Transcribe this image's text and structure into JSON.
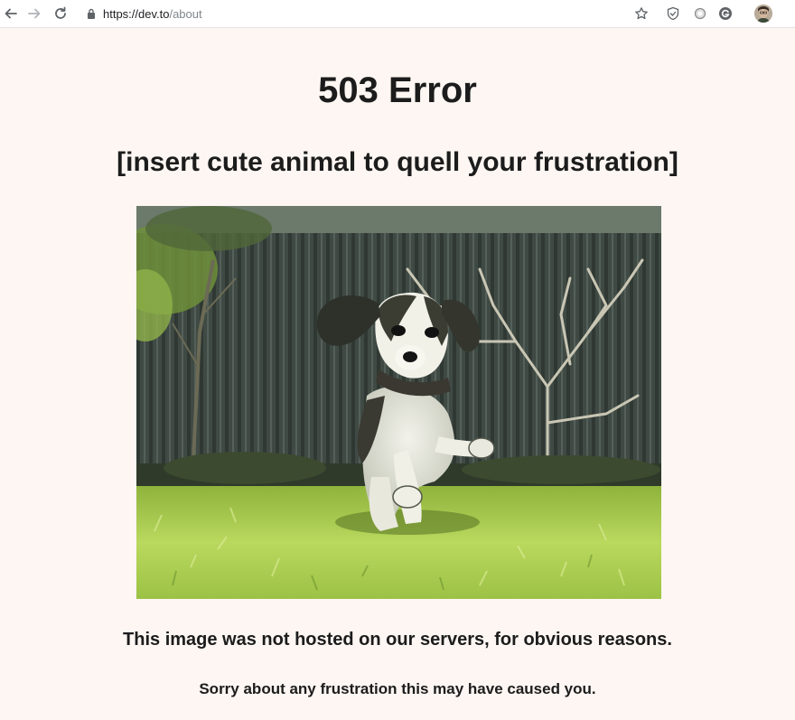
{
  "browser": {
    "url_host": "https://dev.to",
    "url_path": "/about"
  },
  "page": {
    "title": "503 Error",
    "subtitle": "[insert cute animal to quell your frustration]",
    "image_alt": "puppy running on grass",
    "caption": "This image was not hosted on our servers, for obvious reasons.",
    "apology": "Sorry about any frustration this may have caused you."
  },
  "colors": {
    "page_background": "#fdf6f2",
    "text": "#1c1c1c",
    "fence": "#3f4a42",
    "grass": "#b5d45a"
  },
  "icons": [
    "back-icon",
    "forward-icon",
    "reload-icon",
    "lock-icon",
    "star-icon",
    "shield-icon",
    "circle-icon",
    "g-icon",
    "avatar"
  ]
}
